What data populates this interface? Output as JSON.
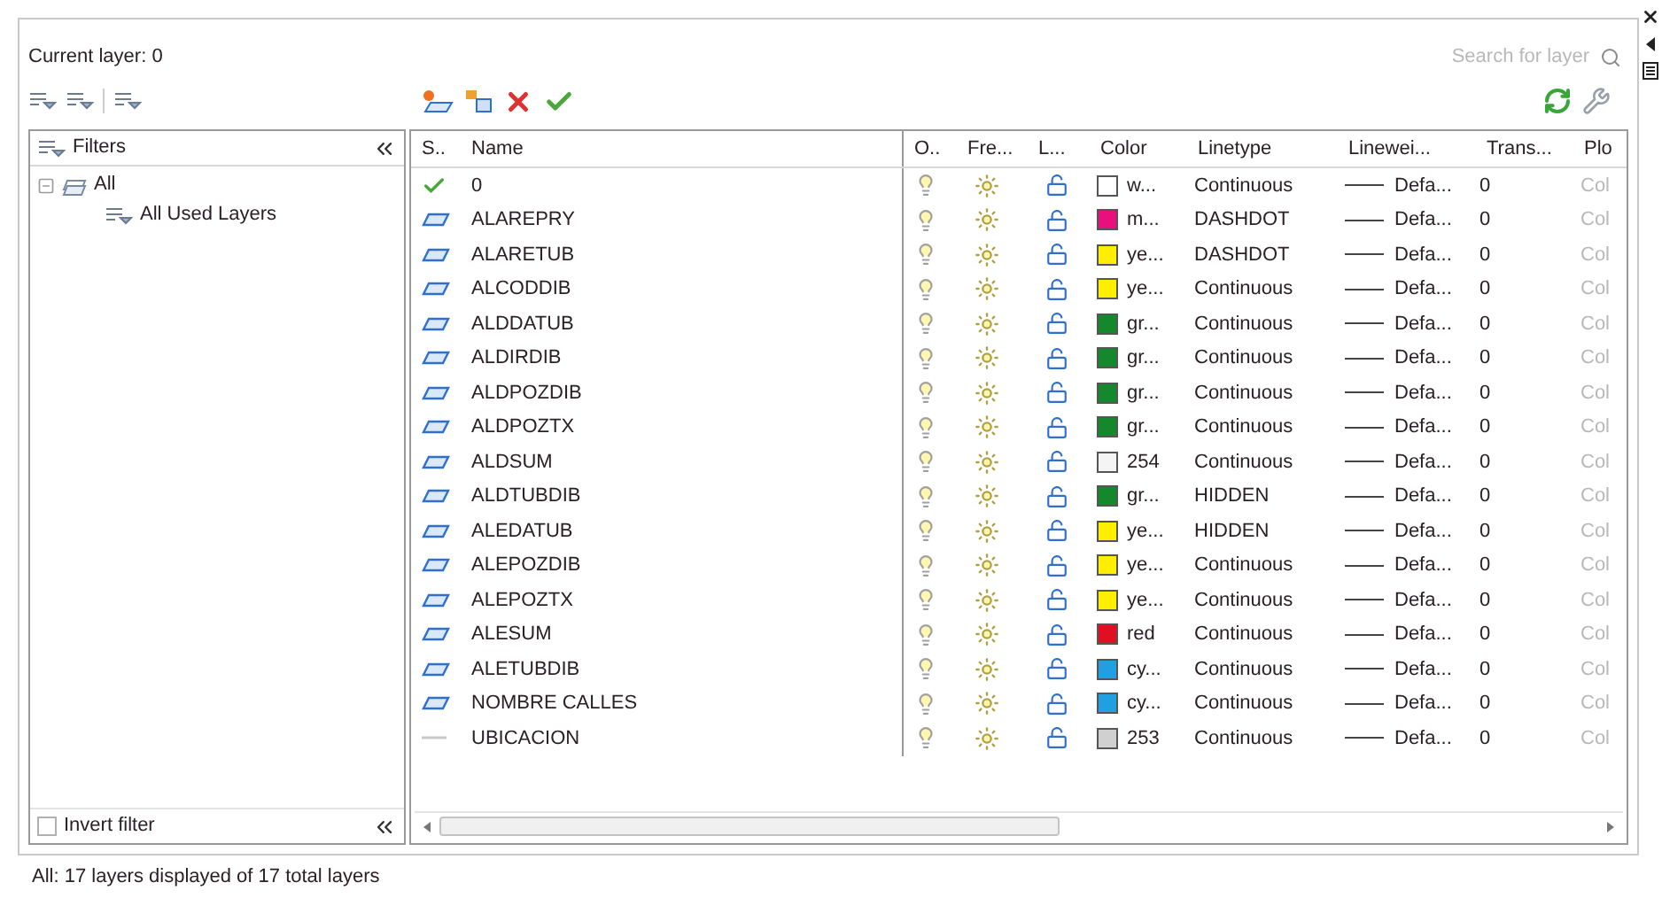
{
  "current_layer": "Current layer: 0",
  "search": {
    "placeholder": "Search for layer"
  },
  "filters": {
    "title": "Filters",
    "tree": [
      {
        "label": "All",
        "expanded": true,
        "children": [
          {
            "label": "All Used Layers"
          }
        ]
      }
    ],
    "invert_filter": {
      "label": "Invert filter",
      "checked": false
    }
  },
  "columns": [
    "S..",
    "Name",
    "O..",
    "Fre...",
    "L...",
    "Color",
    "Linetype",
    "Linewei...",
    "Trans...",
    "Plo"
  ],
  "layers": [
    {
      "kind": "current",
      "name": "0",
      "color": "#ffffff",
      "color_name": "w...",
      "linetype": "Continuous",
      "lineweight": "Defa...",
      "transparency": "0",
      "plot_style": "Col"
    },
    {
      "kind": "used",
      "name": "ALAREPRY",
      "color": "#e8107a",
      "color_name": "m...",
      "linetype": "DASHDOT",
      "lineweight": "Defa...",
      "transparency": "0",
      "plot_style": "Col"
    },
    {
      "kind": "used",
      "name": "ALARETUB",
      "color": "#ffee00",
      "color_name": "ye...",
      "linetype": "DASHDOT",
      "lineweight": "Defa...",
      "transparency": "0",
      "plot_style": "Col"
    },
    {
      "kind": "used",
      "name": "ALCODDIB",
      "color": "#ffee00",
      "color_name": "ye...",
      "linetype": "Continuous",
      "lineweight": "Defa...",
      "transparency": "0",
      "plot_style": "Col"
    },
    {
      "kind": "used",
      "name": "ALDDATUB",
      "color": "#14892c",
      "color_name": "gr...",
      "linetype": "Continuous",
      "lineweight": "Defa...",
      "transparency": "0",
      "plot_style": "Col"
    },
    {
      "kind": "used",
      "name": "ALDIRDIB",
      "color": "#14892c",
      "color_name": "gr...",
      "linetype": "Continuous",
      "lineweight": "Defa...",
      "transparency": "0",
      "plot_style": "Col"
    },
    {
      "kind": "used",
      "name": "ALDPOZDIB",
      "color": "#14892c",
      "color_name": "gr...",
      "linetype": "Continuous",
      "lineweight": "Defa...",
      "transparency": "0",
      "plot_style": "Col"
    },
    {
      "kind": "used",
      "name": "ALDPOZTX",
      "color": "#14892c",
      "color_name": "gr...",
      "linetype": "Continuous",
      "lineweight": "Defa...",
      "transparency": "0",
      "plot_style": "Col"
    },
    {
      "kind": "used",
      "name": "ALDSUM",
      "color": "#f4f4f4",
      "color_name": "254",
      "linetype": "Continuous",
      "lineweight": "Defa...",
      "transparency": "0",
      "plot_style": "Col"
    },
    {
      "kind": "used",
      "name": "ALDTUBDIB",
      "color": "#14892c",
      "color_name": "gr...",
      "linetype": "HIDDEN",
      "lineweight": "Defa...",
      "transparency": "0",
      "plot_style": "Col"
    },
    {
      "kind": "used",
      "name": "ALEDATUB",
      "color": "#ffee00",
      "color_name": "ye...",
      "linetype": "HIDDEN",
      "lineweight": "Defa...",
      "transparency": "0",
      "plot_style": "Col"
    },
    {
      "kind": "used",
      "name": "ALEPOZDIB",
      "color": "#ffee00",
      "color_name": "ye...",
      "linetype": "Continuous",
      "lineweight": "Defa...",
      "transparency": "0",
      "plot_style": "Col"
    },
    {
      "kind": "used",
      "name": "ALEPOZTX",
      "color": "#ffee00",
      "color_name": "ye...",
      "linetype": "Continuous",
      "lineweight": "Defa...",
      "transparency": "0",
      "plot_style": "Col"
    },
    {
      "kind": "used",
      "name": "ALESUM",
      "color": "#e01020",
      "color_name": "red",
      "linetype": "Continuous",
      "lineweight": "Defa...",
      "transparency": "0",
      "plot_style": "Col"
    },
    {
      "kind": "used",
      "name": "ALETUBDIB",
      "color": "#20a0e0",
      "color_name": "cy...",
      "linetype": "Continuous",
      "lineweight": "Defa...",
      "transparency": "0",
      "plot_style": "Col"
    },
    {
      "kind": "used",
      "name": "NOMBRE CALLES",
      "color": "#20a0e0",
      "color_name": "cy...",
      "linetype": "Continuous",
      "lineweight": "Defa...",
      "transparency": "0",
      "plot_style": "Col"
    },
    {
      "kind": "unused",
      "name": "UBICACION",
      "color": "#d0d0d0",
      "color_name": "253",
      "linetype": "Continuous",
      "lineweight": "Defa...",
      "transparency": "0",
      "plot_style": "Col"
    }
  ],
  "status_bar": "All: 17 layers displayed of 17 total layers"
}
